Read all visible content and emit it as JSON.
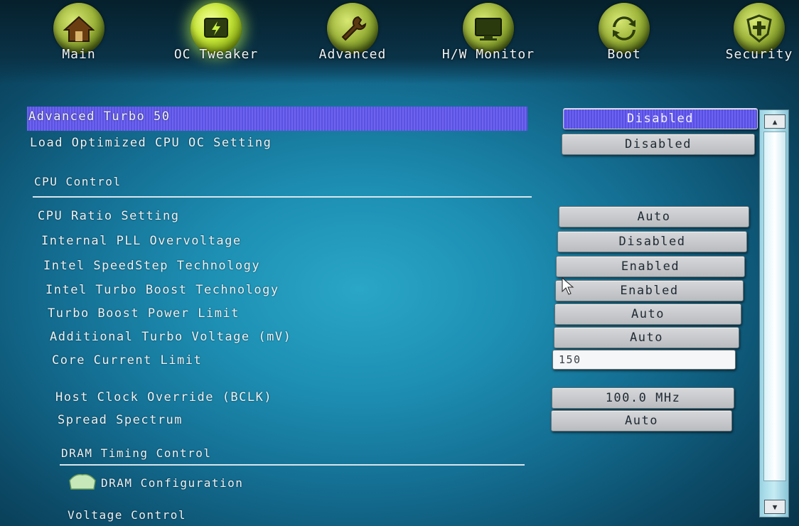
{
  "tabs": [
    {
      "label": "Main",
      "icon": "home-icon"
    },
    {
      "label": "OC Tweaker",
      "icon": "oc-tweaker-icon"
    },
    {
      "label": "Advanced",
      "icon": "wrench-icon"
    },
    {
      "label": "H/W Monitor",
      "icon": "monitor-icon"
    },
    {
      "label": "Boot",
      "icon": "refresh-icon"
    },
    {
      "label": "Security",
      "icon": "shield-icon"
    }
  ],
  "active_tab": "OC Tweaker",
  "settings": {
    "advanced_turbo": {
      "label": "Advanced Turbo 50",
      "value": "Disabled"
    },
    "load_optimized": {
      "label": "Load Optimized CPU OC Setting",
      "value": "Disabled"
    },
    "cpu_control": {
      "label": "CPU Control"
    },
    "cpu_ratio": {
      "label": "CPU Ratio Setting",
      "value": "Auto"
    },
    "internal_pll": {
      "label": "Internal PLL Overvoltage",
      "value": "Disabled"
    },
    "speedstep": {
      "label": "Intel SpeedStep Technology",
      "value": "Enabled"
    },
    "turbo_boost": {
      "label": "Intel Turbo Boost Technology",
      "value": "Enabled"
    },
    "turbo_power_limit": {
      "label": "Turbo Boost Power Limit",
      "value": "Auto"
    },
    "additional_turbo_voltage": {
      "label": "Additional Turbo Voltage (mV)",
      "value": "Auto"
    },
    "core_current_limit": {
      "label": "Core Current Limit",
      "value": "150"
    },
    "host_clock": {
      "label": "Host Clock Override (BCLK)",
      "value": "100.0 MHz"
    },
    "spread_spectrum": {
      "label": "Spread Spectrum",
      "value": "Auto"
    },
    "dram_timing": {
      "label": "DRAM Timing Control"
    },
    "dram_config": {
      "label": "DRAM Configuration",
      "icon": "folder-icon"
    },
    "voltage_control": {
      "label": "Voltage Control"
    }
  },
  "colors": {
    "background": "#146f93",
    "highlight": "#5a52e0",
    "button": "#c8cbce",
    "tab_icon": "#9db43a"
  }
}
